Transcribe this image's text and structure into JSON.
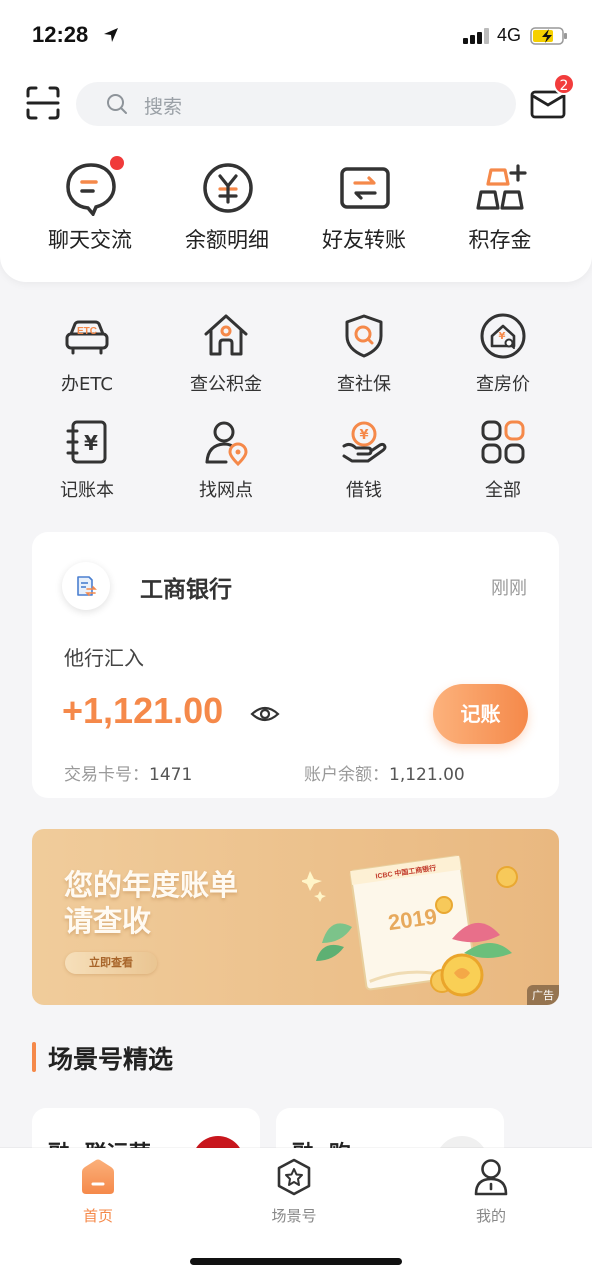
{
  "status_bar": {
    "time": "12:28",
    "network": "4G"
  },
  "search": {
    "placeholder": "搜索"
  },
  "mail": {
    "badge_count": "2"
  },
  "top_actions": [
    {
      "label": "聊天交流",
      "icon": "chat-icon"
    },
    {
      "label": "余额明细",
      "icon": "yuan-circle-icon"
    },
    {
      "label": "好友转账",
      "icon": "transfer-icon"
    },
    {
      "label": "积存金",
      "icon": "gold-bars-icon"
    }
  ],
  "services": [
    {
      "label": "办ETC",
      "icon": "etc-car-icon"
    },
    {
      "label": "查公积金",
      "icon": "house-fund-icon"
    },
    {
      "label": "查社保",
      "icon": "social-security-shield-icon"
    },
    {
      "label": "查房价",
      "icon": "house-price-icon"
    },
    {
      "label": "记账本",
      "icon": "ledger-book-icon"
    },
    {
      "label": "找网点",
      "icon": "branch-location-icon"
    },
    {
      "label": "借钱",
      "icon": "borrow-money-icon"
    },
    {
      "label": "全部",
      "icon": "all-apps-icon"
    }
  ],
  "notification": {
    "bank": "工商银行",
    "time": "刚刚",
    "type": "他行汇入",
    "amount": "+1,121.00",
    "record_label": "记账",
    "card_label": "交易卡号：",
    "card_no": "1471",
    "balance_label": "账户余额：",
    "balance": "1,121.00"
  },
  "banner": {
    "title_line1": "您的年度账单",
    "title_line2": "请查收",
    "button": "立即查看",
    "calendar_year": "2019",
    "calendar_brand": "ICBC 中国工商银行",
    "ad_tag": "广告"
  },
  "section": {
    "title": "场景号精选",
    "cards": [
      {
        "name": "融e联运营"
      },
      {
        "name": "融e购"
      }
    ]
  },
  "bottom_nav": [
    {
      "label": "首页",
      "active": true
    },
    {
      "label": "场景号",
      "active": false
    },
    {
      "label": "我的",
      "active": false
    }
  ],
  "colors": {
    "accent": "#f5894a",
    "badge_red": "#f23c3c",
    "text_dark": "#333333"
  }
}
